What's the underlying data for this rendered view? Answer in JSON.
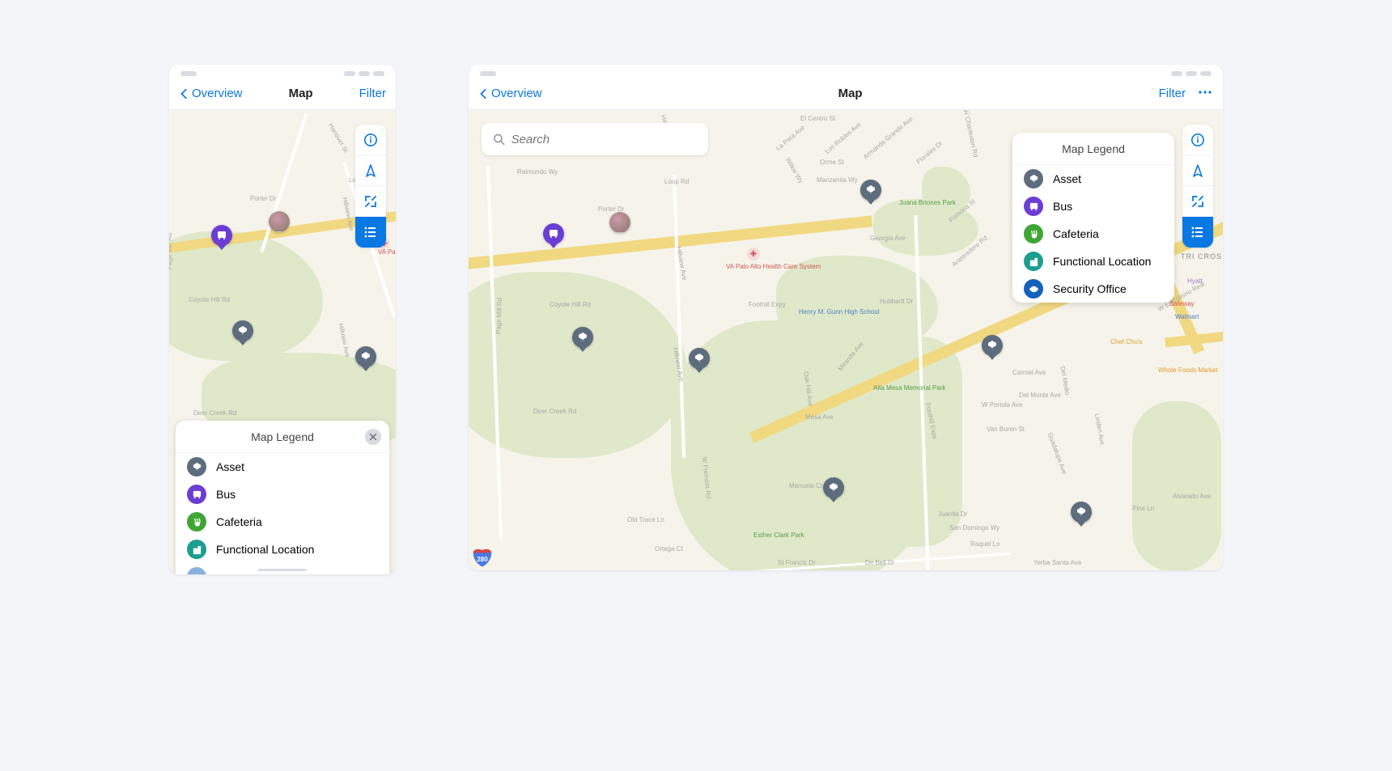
{
  "nav": {
    "back_label": "Overview",
    "title": "Map",
    "filter_label": "Filter"
  },
  "search": {
    "placeholder": "Search"
  },
  "legend": {
    "title": "Map Legend",
    "items": [
      {
        "slug": "asset",
        "label": "Asset"
      },
      {
        "slug": "bus",
        "label": "Bus"
      },
      {
        "slug": "cafeteria",
        "label": "Cafeteria"
      },
      {
        "slug": "functional",
        "label": "Functional Location"
      },
      {
        "slug": "security",
        "label": "Security Office"
      }
    ]
  },
  "toolbar": {
    "info": "info-icon",
    "locate": "compass-icon",
    "expand": "expand-icon",
    "legend": "list-icon"
  },
  "map_labels": {
    "coyote_hill": "Coyote Hill Rd",
    "deer_creek": "Deer Creek Rd",
    "page_mill": "Page Mill Rd",
    "hillview": "Hillview Ave",
    "porter": "Porter Dr",
    "hanover": "Hanover St",
    "loop": "Loop Rd",
    "raimundo": "Raimundo Wy",
    "foothill": "Foothill Expy",
    "arastradero": "Arastradero Rd",
    "manzanita": "Manzanita Wy",
    "lapara": "La Para Ave",
    "orme": "Orme St",
    "florales": "Florales Dr",
    "armanda": "Armanda Grande Ave",
    "elcentro": "El Centro St",
    "losrobles": "Los Robles Ave",
    "wilkie": "Wilkie Wy",
    "wcharleston": "W Charleston Rd",
    "hubbartt": "Hubbartt Dr",
    "georgia": "Georgia Ave",
    "pomona": "Pomona St",
    "miranda": "Miranda Ave",
    "oakhill": "Oak Hill Ave",
    "mesa": "Mesa Ave",
    "manuela": "Manuela Ct",
    "oldtrace": "Old Trace Ln",
    "ortega": "Ortega Ct",
    "stfrancis": "St Francis Dr",
    "debell": "De Bell Dr",
    "fremont": "W Fremont Rd",
    "wportola": "W Portola Ave",
    "delmonte": "Del Monte Ave",
    "vanburen": "Van Buren St",
    "carmel": "Carmel Ave",
    "delmedio": "Del Medio",
    "linden": "Linden Ave",
    "guadalupe": "Guadalupe Ave",
    "juanita": "Juanita Dr",
    "sandomingo": "San Domingo Wy",
    "rocquel": "Raquel Ln",
    "yerbasanta": "Yerba Santa Ave",
    "pine": "Pine Ln",
    "alvarado": "Alvarado Ave",
    "camino": "W El Camino Real",
    "tri_cross": "TRI CROS",
    "va_palo_alto": "VA Palo Alto Health Care System",
    "va_short": "VA Pal",
    "gunn_hs": "Henry M. Gunn High School",
    "esther_park": "Esther Clark Park",
    "briones_park": "Juana Briones Park",
    "alta_mesa": "Alta Mesa Memorial Park",
    "walmart": "Walmart",
    "whole_foods": "Whole Foods Market",
    "chef_chu": "Chef Chu's",
    "safeway": "Safeway",
    "hyatt": "Hyatt",
    "i280": "280"
  },
  "colors": {
    "blue": "#0a78e3",
    "asset": "#5d6d7e",
    "bus": "#6b3dd4",
    "cafeteria": "#3fa535",
    "functional": "#1a9e8f",
    "security": "#1560bd"
  }
}
